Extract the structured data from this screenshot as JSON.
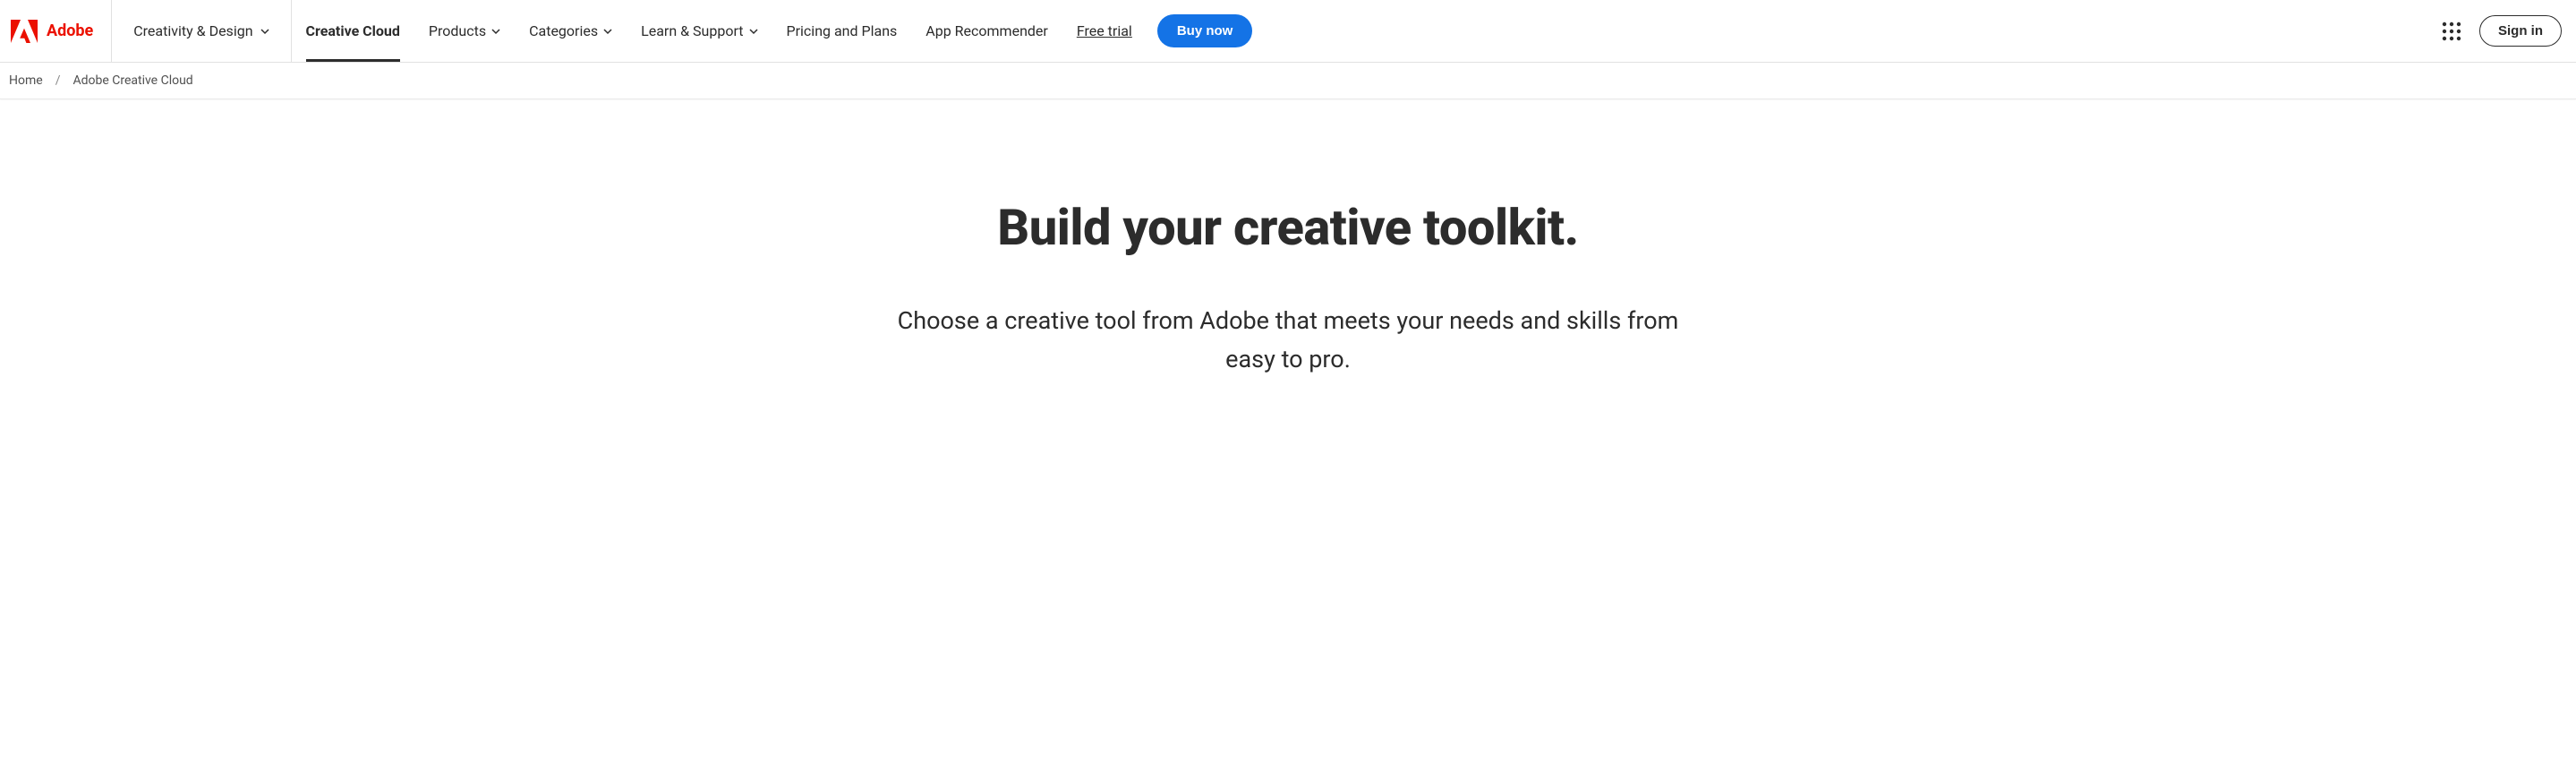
{
  "brand": {
    "name": "Adobe"
  },
  "primaryNav": {
    "categoryLabel": "Creativity & Design",
    "items": [
      {
        "label": "Creative Cloud",
        "active": true,
        "hasDropdown": false
      },
      {
        "label": "Products",
        "active": false,
        "hasDropdown": true
      },
      {
        "label": "Categories",
        "active": false,
        "hasDropdown": true
      },
      {
        "label": "Learn & Support",
        "active": false,
        "hasDropdown": true
      },
      {
        "label": "Pricing and Plans",
        "active": false,
        "hasDropdown": false
      },
      {
        "label": "App Recommender",
        "active": false,
        "hasDropdown": false
      }
    ],
    "freeTrialLabel": "Free trial",
    "buyNowLabel": "Buy now",
    "signInLabel": "Sign in"
  },
  "breadcrumb": {
    "items": [
      {
        "label": "Home"
      },
      {
        "label": "Adobe Creative Cloud"
      }
    ]
  },
  "hero": {
    "title": "Build your creative toolkit.",
    "subtitle": "Choose a creative tool from Adobe that meets your needs and skills from easy to pro."
  }
}
